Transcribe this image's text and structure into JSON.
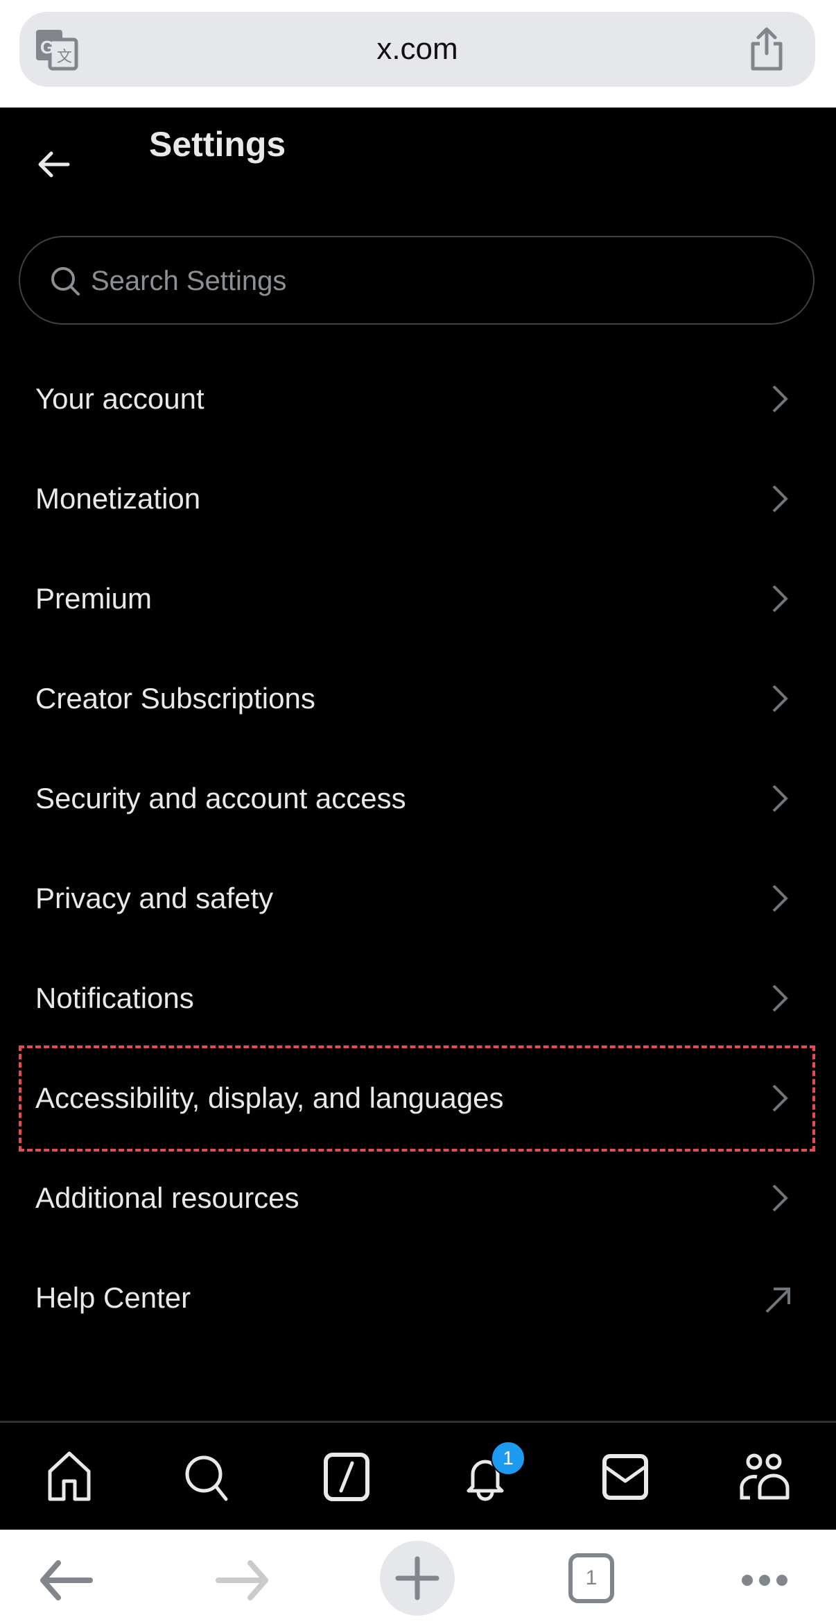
{
  "browser": {
    "url": "x.com",
    "translate_icon": "google-translate-icon",
    "share_icon": "share-icon",
    "bottom_bar": {
      "back_icon": "arrow-left-icon",
      "forward_icon": "arrow-right-icon",
      "new_tab_icon": "plus-icon",
      "tab_count": "1",
      "more_icon": "ellipsis-icon"
    }
  },
  "header": {
    "title": "Settings",
    "back_icon": "arrow-left-icon"
  },
  "search": {
    "placeholder": "Search Settings",
    "value": ""
  },
  "menu": {
    "items": [
      {
        "label": "Your account",
        "icon": "chevron-right-icon"
      },
      {
        "label": "Monetization",
        "icon": "chevron-right-icon"
      },
      {
        "label": "Premium",
        "icon": "chevron-right-icon"
      },
      {
        "label": "Creator Subscriptions",
        "icon": "chevron-right-icon"
      },
      {
        "label": "Security and account access",
        "icon": "chevron-right-icon"
      },
      {
        "label": "Privacy and safety",
        "icon": "chevron-right-icon"
      },
      {
        "label": "Notifications",
        "icon": "chevron-right-icon"
      },
      {
        "label": "Accessibility, display, and languages",
        "icon": "chevron-right-icon",
        "highlighted": true
      },
      {
        "label": "Additional resources",
        "icon": "chevron-right-icon"
      },
      {
        "label": "Help Center",
        "icon": "external-link-arrow-icon"
      }
    ]
  },
  "bottom_nav": {
    "items": [
      {
        "name": "home",
        "icon": "home-icon"
      },
      {
        "name": "explore",
        "icon": "search-icon"
      },
      {
        "name": "grok",
        "icon": "grok-icon"
      },
      {
        "name": "notifications",
        "icon": "bell-icon",
        "badge": "1"
      },
      {
        "name": "messages",
        "icon": "mail-icon"
      },
      {
        "name": "communities",
        "icon": "people-icon"
      }
    ]
  },
  "colors": {
    "background": "#000000",
    "text": "#e7e9ea",
    "muted": "#71767b",
    "accent": "#1d9bf0",
    "highlight_border": "#e84a4f"
  }
}
